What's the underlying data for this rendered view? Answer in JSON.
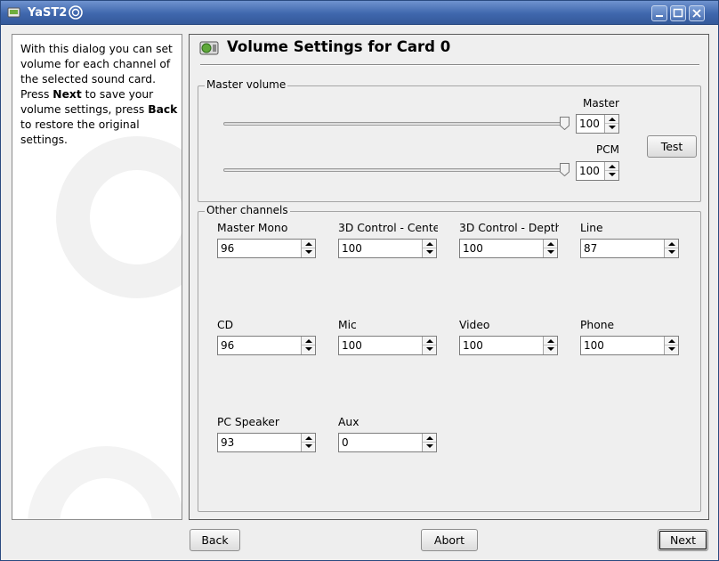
{
  "window": {
    "title": "YaST2"
  },
  "help": {
    "lines": [
      "With this dialog you can set",
      "volume for each channel of",
      "the selected sound card.",
      "Press ",
      "Next",
      " to save your",
      "volume settings, press ",
      "Back",
      "to restore the original",
      "settings."
    ]
  },
  "dialog": {
    "title": "Volume Settings for Card 0"
  },
  "master_group": {
    "title": "Master volume",
    "master": {
      "label": "Master",
      "value": "100",
      "level_percent": 100
    },
    "pcm": {
      "label": "PCM",
      "value": "100",
      "level_percent": 100
    },
    "test_label": "Test"
  },
  "other_group": {
    "title": "Other channels",
    "channels": [
      {
        "label": "Master Mono",
        "value": "96"
      },
      {
        "label": "3D Control - Cente",
        "value": "100"
      },
      {
        "label": "3D Control - Depth",
        "value": "100"
      },
      {
        "label": "Line",
        "value": "87"
      },
      {
        "label": "CD",
        "value": "96"
      },
      {
        "label": "Mic",
        "value": "100"
      },
      {
        "label": "Video",
        "value": "100"
      },
      {
        "label": "Phone",
        "value": "100"
      },
      {
        "label": "PC Speaker",
        "value": "93"
      },
      {
        "label": "Aux",
        "value": "0"
      }
    ]
  },
  "buttons": {
    "back": "Back",
    "abort": "Abort",
    "next": "Next"
  }
}
